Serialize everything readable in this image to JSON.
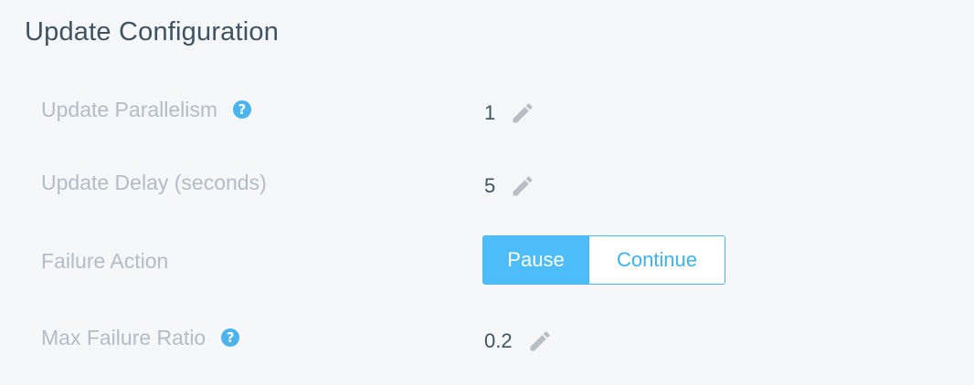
{
  "section": {
    "title": "Update Configuration"
  },
  "rows": {
    "parallelism": {
      "label": "Update Parallelism",
      "help_icon": "question-circle-icon",
      "help_glyph": "?",
      "value": "1",
      "edit_icon": "pencil-icon"
    },
    "delay": {
      "label": "Update Delay (seconds)",
      "value": "5",
      "edit_icon": "pencil-icon"
    },
    "failure_action": {
      "label": "Failure Action",
      "options": [
        "Pause",
        "Continue"
      ],
      "selected": "Pause"
    },
    "max_failure_ratio": {
      "label": "Max Failure Ratio",
      "help_icon": "question-circle-icon",
      "help_glyph": "?",
      "value": "0.2",
      "edit_icon": "pencil-icon"
    }
  },
  "colors": {
    "background": "#f6f7f9",
    "title_text": "#3f5363",
    "label_text": "#b4bcc6",
    "accent": "#4cb4ec",
    "toggle_active_bg": "#4cbdf8",
    "pencil": "#b9bec4"
  }
}
